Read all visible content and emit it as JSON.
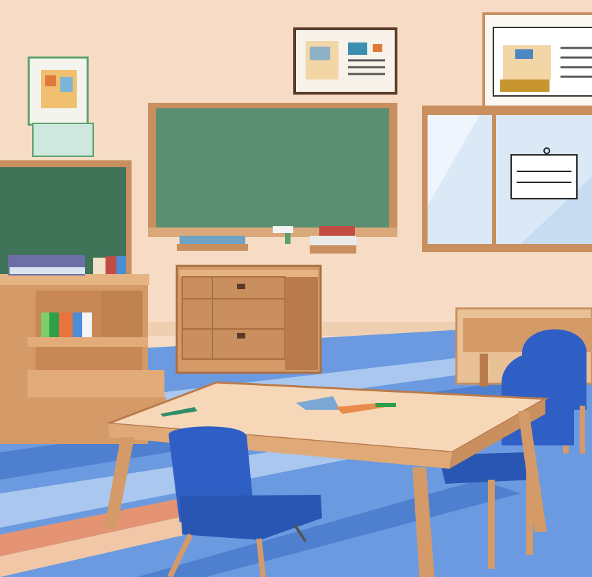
{
  "scene": {
    "kind": "illustration",
    "setting": "classroom",
    "visible_text": []
  },
  "palette": {
    "wall": "#f6dcc4",
    "board_green": "#5a8f72",
    "board_frame": "#c98f5e",
    "wood": "#d49a68",
    "wood_dark": "#a96f43",
    "floor_blue": "#5d8fd8",
    "floor_light": "#a9c7ef",
    "floor_orange": "#e49373",
    "chair_blue": "#2f5fc4",
    "window_glass": "#dbe9f7",
    "table_top": "#f6d8b8"
  },
  "objects": [
    {
      "name": "left-chalkboard",
      "icon": "chalkboard"
    },
    {
      "name": "center-chalkboard",
      "icon": "chalkboard"
    },
    {
      "name": "window",
      "icon": "window"
    },
    {
      "name": "framed-picture-small",
      "icon": "picture"
    },
    {
      "name": "framed-picture-center",
      "icon": "picture"
    },
    {
      "name": "framed-picture-right",
      "icon": "picture"
    },
    {
      "name": "bookshelf",
      "icon": "shelf"
    },
    {
      "name": "drawer-cabinet",
      "icon": "cabinet"
    },
    {
      "name": "study-table",
      "icon": "table"
    },
    {
      "name": "blue-chair",
      "icon": "chair",
      "count": 3
    }
  ]
}
